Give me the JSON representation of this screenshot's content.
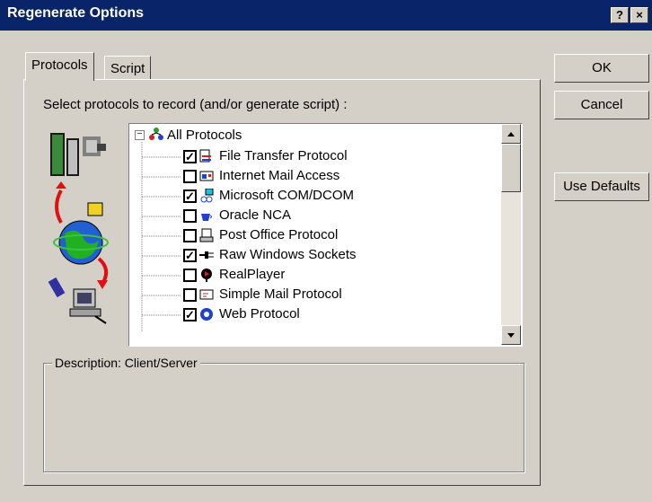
{
  "window": {
    "title": "Regenerate Options",
    "help_btn": "?",
    "close_btn": "×"
  },
  "tabs": [
    {
      "label": "Protocols"
    },
    {
      "label": "Script"
    }
  ],
  "instruction": "Select protocols to record (and/or generate script) :",
  "tree": {
    "root_label": "All Protocols",
    "items": [
      {
        "label": "File Transfer Protocol",
        "checked": true
      },
      {
        "label": "Internet Mail Access",
        "checked": false
      },
      {
        "label": "Microsoft COM/DCOM",
        "checked": true
      },
      {
        "label": "Oracle NCA",
        "checked": false
      },
      {
        "label": "Post Office Protocol",
        "checked": false
      },
      {
        "label": "Raw Windows Sockets",
        "checked": true
      },
      {
        "label": "RealPlayer",
        "checked": false
      },
      {
        "label": "Simple Mail Protocol",
        "checked": false
      },
      {
        "label": "Web Protocol",
        "checked": true
      }
    ]
  },
  "description": {
    "label": "Description: Client/Server"
  },
  "buttons": {
    "ok": "OK",
    "cancel": "Cancel",
    "use_defaults": "Use Defaults"
  },
  "colors": {
    "titlebar": "#0a246a",
    "face": "#d4d0c8",
    "arrow": "#e01010"
  }
}
